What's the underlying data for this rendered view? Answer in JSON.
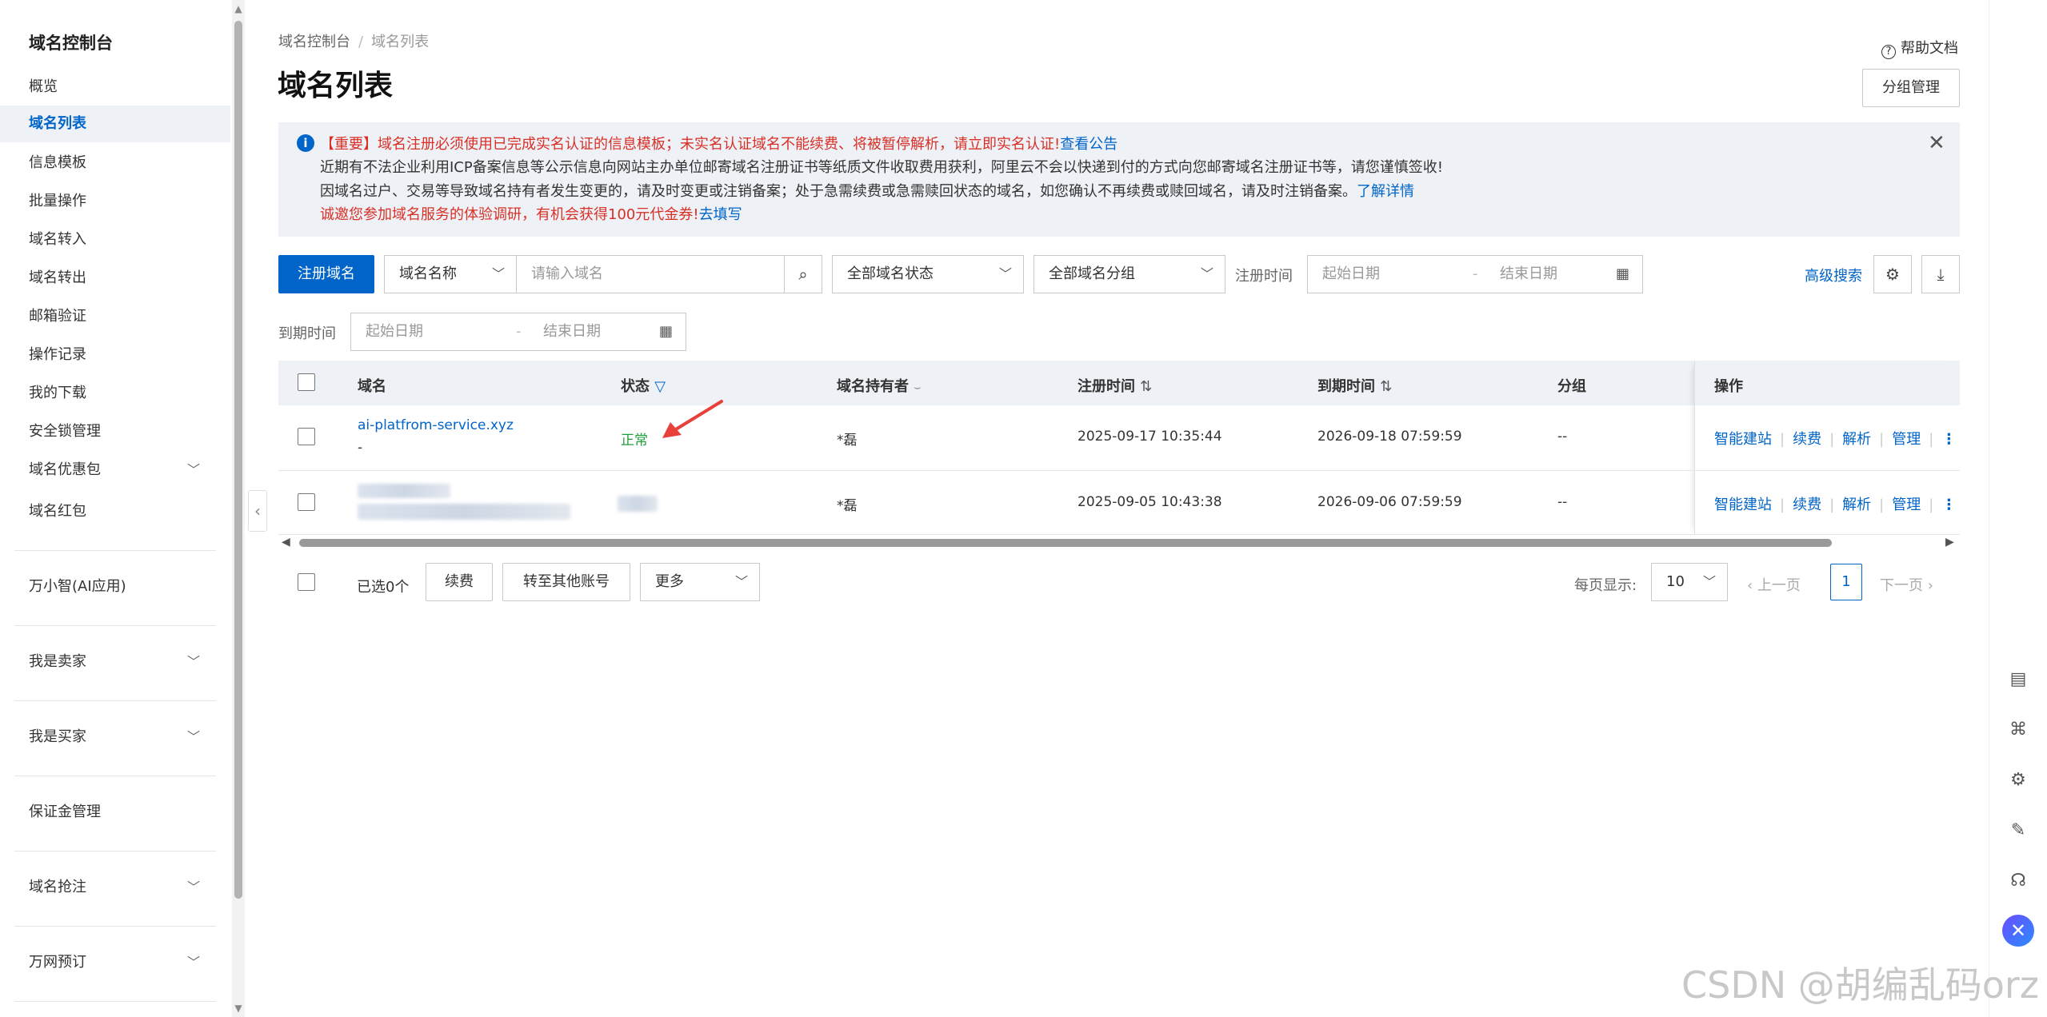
{
  "sidebar": {
    "title": "域名控制台",
    "items": [
      {
        "label": "概览"
      },
      {
        "label": "域名列表",
        "active": true
      },
      {
        "label": "信息模板"
      },
      {
        "label": "批量操作"
      },
      {
        "label": "域名转入"
      },
      {
        "label": "域名转出"
      },
      {
        "label": "邮箱验证"
      },
      {
        "label": "操作记录"
      },
      {
        "label": "我的下载"
      },
      {
        "label": "安全锁管理"
      },
      {
        "label": "域名优惠包",
        "expandable": true
      },
      {
        "label": "域名红包"
      }
    ],
    "sections": [
      {
        "label": "万小智(AI应用)"
      },
      {
        "label": "我是卖家",
        "expandable": true
      },
      {
        "label": "我是买家",
        "expandable": true
      },
      {
        "label": "保证金管理"
      },
      {
        "label": "域名抢注",
        "expandable": true
      },
      {
        "label": "万网预订",
        "expandable": true
      }
    ]
  },
  "breadcrumb": {
    "root": "域名控制台",
    "sep": "/",
    "current": "域名列表"
  },
  "page_title": "域名列表",
  "help_docs": "帮助文档",
  "group_manage": "分组管理",
  "notice": {
    "line1_prefix": "【重要】域名注册必须使用已完成实名认证的信息模板；未实名认证域名不能续费、将被暂停解析，请立即实名认证!",
    "line1_link": "查看公告",
    "line2": "近期有不法企业利用ICP备案信息等公示信息向网站主办单位邮寄域名注册证书等纸质文件收取费用获利，阿里云不会以快递到付的方式向您邮寄域名注册证书等，请您谨慎签收!",
    "line3_prefix": "因域名过户、交易等导致域名持有者发生变更的，请及时变更或注销备案；处于急需续费或急需赎回状态的域名，如您确认不再续费或赎回域名，请及时注销备案。",
    "line3_link": "了解详情",
    "line4_prefix": "诚邀您参加域名服务的体验调研，有机会获得100元代金券!",
    "line4_link": "去填写"
  },
  "toolbar": {
    "register_label": "注册域名",
    "search_type": "域名名称",
    "search_placeholder": "请输入域名",
    "status_select": "全部域名状态",
    "group_select": "全部域名分组",
    "reg_time_label": "注册时间",
    "start_date": "起始日期",
    "range_sep": "-",
    "end_date": "结束日期",
    "exp_time_label": "到期时间",
    "advanced_search": "高级搜索"
  },
  "table": {
    "headers": {
      "domain": "域名",
      "status": "状态",
      "holder": "域名持有者",
      "reg_time": "注册时间",
      "exp_time": "到期时间",
      "group": "分组",
      "ops": "操作"
    },
    "rows": [
      {
        "domain": "ai-platfrom-service.xyz",
        "domain_sub": "-",
        "status": "正常",
        "holder": "*磊",
        "reg_time": "2025-09-17 10:35:44",
        "exp_time": "2026-09-18 07:59:59",
        "group": "--"
      },
      {
        "domain": "",
        "status": "",
        "holder": "*磊",
        "reg_time": "2025-09-05 10:43:38",
        "exp_time": "2026-09-06 07:59:59",
        "group": "--"
      }
    ],
    "ops": [
      "智能建站",
      "续费",
      "解析",
      "管理"
    ]
  },
  "footer": {
    "selected": "已选0个",
    "renew": "续费",
    "transfer": "转至其他账号",
    "more": "更多",
    "per_page_label": "每页显示:",
    "per_page_value": "10",
    "prev": "上一页",
    "page": "1",
    "next": "下一页"
  },
  "watermark": "CSDN @胡编乱码orz",
  "colors": {
    "accent": "#0064c8",
    "status_ok": "#1f9e3c",
    "important": "#d93026",
    "annotation_arrow": "#e8403a"
  }
}
